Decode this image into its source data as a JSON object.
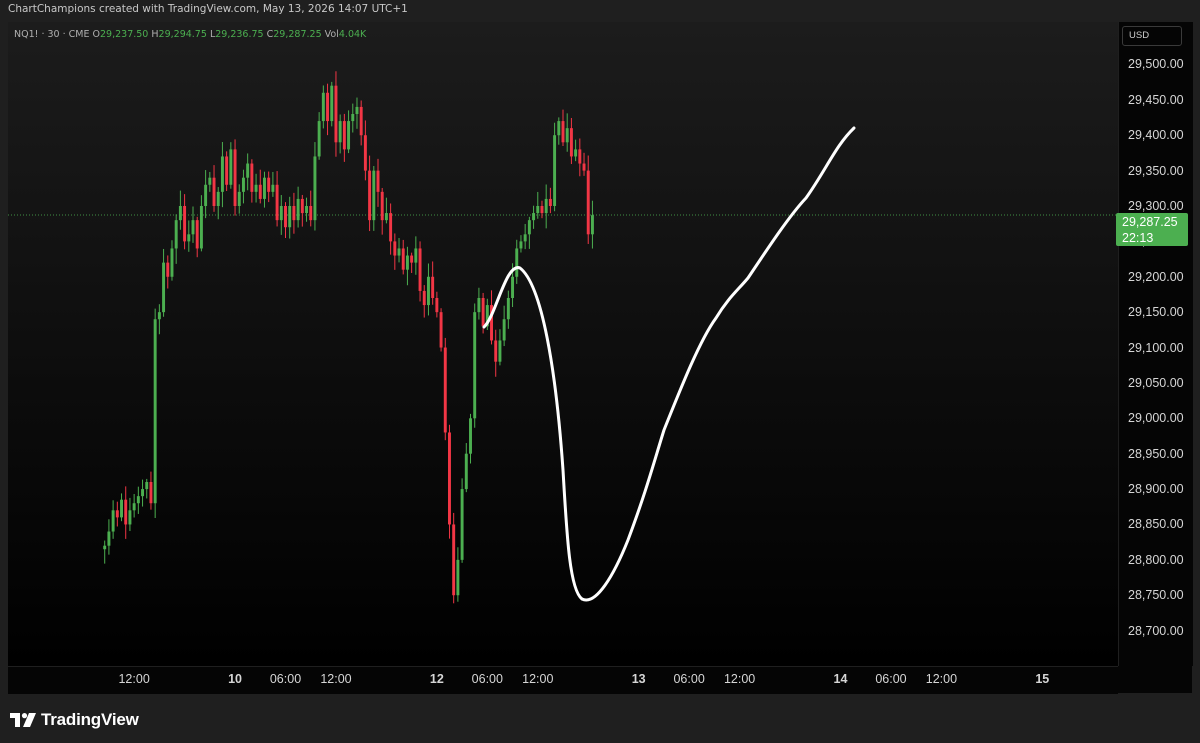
{
  "header": {
    "text": "ChartChampions created with TradingView.com, May 13, 2026 14:07 UTC+1"
  },
  "legend": {
    "symbol": "NQ1! · 30 · CME",
    "o_label": "O",
    "o": "29,237.50",
    "h_label": "H",
    "h": "29,294.75",
    "l_label": "L",
    "l": "29,236.75",
    "c_label": "C",
    "c": "29,287.25",
    "vol_label": "Vol",
    "vol": "4.04K"
  },
  "currency": "USD",
  "price_tag": {
    "price": "29,287.25",
    "countdown": "22:13"
  },
  "brand": {
    "name": "TradingView"
  },
  "colors": {
    "up": "#4caf50",
    "down": "#f23645",
    "drawing": "#ffffff",
    "last_price_line": "#4caf50"
  },
  "chart_data": {
    "type": "candlestick",
    "symbol": "NQ1!",
    "interval": "30",
    "exchange": "CME",
    "ylim": [
      28650,
      29560
    ],
    "y_ticks": [
      28700,
      28750,
      28800,
      28850,
      28900,
      28950,
      29000,
      29050,
      29100,
      29150,
      29200,
      29250,
      29300,
      29350,
      29400,
      29450,
      29500
    ],
    "y_tick_labels": [
      "28,700.00",
      "28,750.00",
      "28,800.00",
      "28,850.00",
      "28,900.00",
      "28,950.00",
      "29,000.00",
      "29,050.00",
      "29,100.00",
      "29,150.00",
      "29,200.00",
      "29,250.00",
      "29,300.00",
      "29,350.00",
      "29,400.00",
      "29,450.00",
      "29,500.00"
    ],
    "last_price": 29287.25,
    "x_range_hours": [
      -15,
      117
    ],
    "x_ticks": [
      {
        "t": 0,
        "label": "12:00",
        "bold": false
      },
      {
        "t": 12,
        "label": "10",
        "bold": true
      },
      {
        "t": 18,
        "label": "06:00",
        "bold": false
      },
      {
        "t": 24,
        "label": "12:00",
        "bold": false
      },
      {
        "t": 36,
        "label": "12",
        "bold": true
      },
      {
        "t": 42,
        "label": "06:00",
        "bold": false
      },
      {
        "t": 48,
        "label": "12:00",
        "bold": false
      },
      {
        "t": 60,
        "label": "13",
        "bold": true
      },
      {
        "t": 66,
        "label": "06:00",
        "bold": false
      },
      {
        "t": 72,
        "label": "12:00",
        "bold": false
      },
      {
        "t": 84,
        "label": "14",
        "bold": true
      },
      {
        "t": 90,
        "label": "06:00",
        "bold": false
      },
      {
        "t": 96,
        "label": "12:00",
        "bold": false
      },
      {
        "t": 108,
        "label": "15",
        "bold": true
      }
    ],
    "candle_interval_hours": 0.5,
    "candles_start_hour": -3.5,
    "closes": [
      28820,
      28840,
      28870,
      28860,
      28885,
      28850,
      28870,
      28880,
      28890,
      28900,
      28910,
      28880,
      29140,
      29150,
      29220,
      29200,
      29240,
      29280,
      29300,
      29250,
      29260,
      29280,
      29240,
      29300,
      29330,
      29340,
      29300,
      29320,
      29370,
      29330,
      29380,
      29300,
      29320,
      29340,
      29360,
      29320,
      29330,
      29310,
      29340,
      29320,
      29330,
      29280,
      29300,
      29270,
      29300,
      29280,
      29310,
      29290,
      29300,
      29280,
      29370,
      29420,
      29460,
      29420,
      29470,
      29390,
      29420,
      29380,
      29420,
      29430,
      29440,
      29400,
      29350,
      29280,
      29350,
      29320,
      29280,
      29290,
      29250,
      29230,
      29240,
      29210,
      29230,
      29220,
      29240,
      29180,
      29160,
      29200,
      29170,
      29150,
      29100,
      28980,
      28850,
      28750,
      28800,
      28900,
      28950,
      29000,
      29150,
      29170,
      29130,
      29160,
      29110,
      29080,
      29110,
      29140,
      29170,
      29200,
      29240,
      29250,
      29260,
      29280,
      29290,
      29300,
      29290,
      29310,
      29300,
      29400,
      29420,
      29390,
      29410,
      29370,
      29380,
      29360,
      29350,
      29260,
      29287
    ]
  }
}
